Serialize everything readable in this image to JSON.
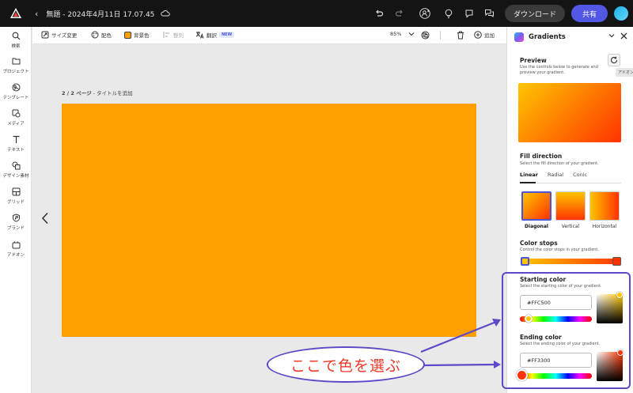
{
  "topbar": {
    "doc_title": "無題 - 2024年4月11日 17.07.45",
    "download_label": "ダウンロード",
    "share_label": "共有"
  },
  "sidebar": {
    "items": [
      {
        "label": "検索",
        "icon": "search-icon"
      },
      {
        "label": "プロジェクト",
        "icon": "folder-icon"
      },
      {
        "label": "テンプレート",
        "icon": "template-icon"
      },
      {
        "label": "メディア",
        "icon": "media-icon"
      },
      {
        "label": "テキスト",
        "icon": "text-icon"
      },
      {
        "label": "デザイン素材",
        "icon": "shapes-icon"
      },
      {
        "label": "グリッド",
        "icon": "grid-icon"
      },
      {
        "label": "ブランド",
        "icon": "brand-icon"
      },
      {
        "label": "アドオン",
        "icon": "addon-icon"
      }
    ]
  },
  "toolbar": {
    "resize_label": "サイズ変更",
    "color_label": "配色",
    "bg_color_label": "背景色",
    "align_label": "整列",
    "translate_label": "翻訳",
    "new_badge": "NEW",
    "zoom": "85%",
    "add_label": "追加"
  },
  "canvas": {
    "page_counter": "2 / 2 ページ",
    "page_title_prompt": "タイトルを追加",
    "page_color": "#ffa000"
  },
  "panel": {
    "title": "Gradients",
    "preview_heading": "Preview",
    "preview_desc": "Use the controls below to generate and preview your gradient.",
    "refresh_tooltip": "アドオン",
    "fill_heading": "Fill direction",
    "fill_desc": "Select the fill direction of your gradient.",
    "tabs": [
      "Linear",
      "Radial",
      "Conic"
    ],
    "directions": [
      "Diagonal",
      "Vertical",
      "Horizontal"
    ],
    "stops_heading": "Color stops",
    "stops_desc": "Control the color stops in your gradient.",
    "start_heading": "Starting color",
    "start_desc": "Select the starting color of your gradient.",
    "start_hex": "#FFC500",
    "end_heading": "Ending color",
    "end_desc": "Select the ending color of your gradient.",
    "end_hex": "#FF3300"
  },
  "annotation": {
    "text": "ここで色を選ぶ"
  },
  "colors": {
    "accent": "#5258e4",
    "start": "#ffc500",
    "end": "#ff3300",
    "annotation_text": "#ea3a2a",
    "annotation_border": "#5f48c8"
  }
}
